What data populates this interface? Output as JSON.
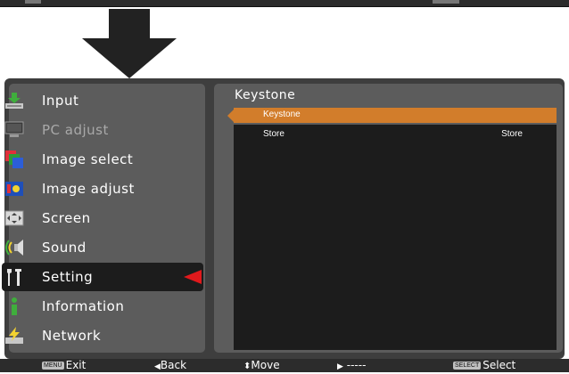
{
  "menu": {
    "items": [
      {
        "label": "Input",
        "icon": "input-icon",
        "dim": false
      },
      {
        "label": "PC adjust",
        "icon": "pc-adjust-icon",
        "dim": true
      },
      {
        "label": "Image select",
        "icon": "image-select-icon",
        "dim": false
      },
      {
        "label": "Image adjust",
        "icon": "image-adjust-icon",
        "dim": false
      },
      {
        "label": "Screen",
        "icon": "screen-icon",
        "dim": false
      },
      {
        "label": "Sound",
        "icon": "sound-icon",
        "dim": false
      },
      {
        "label": "Setting",
        "icon": "setting-icon",
        "dim": false,
        "selected": true
      },
      {
        "label": "Information",
        "icon": "information-icon",
        "dim": false
      },
      {
        "label": "Network",
        "icon": "network-icon",
        "dim": false
      }
    ]
  },
  "submenu": {
    "title": "Keystone",
    "rows": [
      {
        "label": "Keystone",
        "value": ""
      },
      {
        "label": "Store",
        "value": "Store"
      }
    ]
  },
  "footer": {
    "exit_key": "MENU",
    "exit": "Exit",
    "back_arrow": "◀",
    "back": "Back",
    "move_arrow": "⬍",
    "move": "Move",
    "next_arrow": "▶",
    "next": "-----",
    "select_key": "SELECT",
    "select": "Select"
  },
  "colors": {
    "highlight": "#d27d2b",
    "pointer": "#e0191c",
    "panel": "#5c5c5c",
    "inner": "#1c1c1c"
  }
}
